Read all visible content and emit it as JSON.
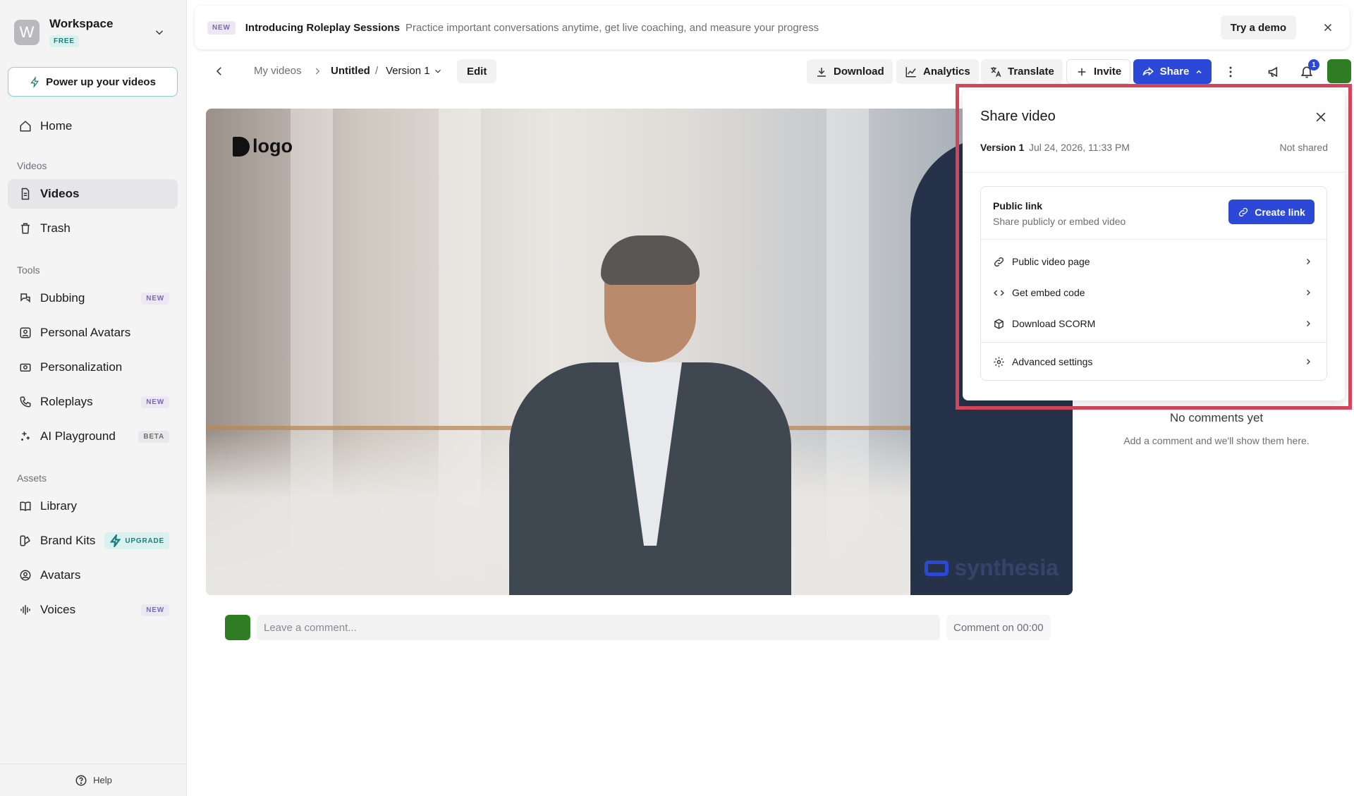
{
  "sidebar": {
    "workspace": {
      "initial": "W",
      "name": "Workspace",
      "plan": "FREE"
    },
    "power_up": "Power up your videos",
    "home": "Home",
    "sections": {
      "videos": "Videos",
      "tools": "Tools",
      "assets": "Assets"
    },
    "videos_items": [
      {
        "label": "Videos",
        "active": true
      },
      {
        "label": "Trash"
      }
    ],
    "tools_items": [
      {
        "label": "Dubbing",
        "badge": "NEW"
      },
      {
        "label": "Personal Avatars"
      },
      {
        "label": "Personalization"
      },
      {
        "label": "Roleplays",
        "badge": "NEW"
      },
      {
        "label": "AI Playground",
        "badge": "BETA"
      }
    ],
    "assets_items": [
      {
        "label": "Library"
      },
      {
        "label": "Brand Kits",
        "badge": "UPGRADE"
      },
      {
        "label": "Avatars"
      },
      {
        "label": "Voices",
        "badge": "NEW"
      }
    ],
    "help": "Help"
  },
  "banner": {
    "badge": "NEW",
    "title": "Introducing Roleplay Sessions",
    "description": "Practice important conversations anytime, get live coaching, and measure your progress",
    "demo": "Try a demo"
  },
  "toolbar": {
    "breadcrumb": {
      "parent": "My videos",
      "title": "Untitled",
      "separator": "/",
      "version": "Version 1"
    },
    "edit": "Edit",
    "download": "Download",
    "analytics": "Analytics",
    "translate": "Translate",
    "invite": "Invite",
    "share": "Share",
    "notifications_count": "1"
  },
  "video": {
    "logo_text": "logo",
    "watermark": "synthesia"
  },
  "comments": {
    "placeholder": "Leave a comment...",
    "timestamp_button": "Comment on 00:00",
    "empty_title": "No comments yet",
    "empty_subtitle": "Add a comment and we'll show them here."
  },
  "share_panel": {
    "title": "Share video",
    "version": "Version 1",
    "date": "Jul 24, 2026, 11:33 PM",
    "status": "Not shared",
    "public_link": {
      "title": "Public link",
      "subtitle": "Share publicly or embed video",
      "button": "Create link"
    },
    "options": {
      "public_page": "Public video page",
      "embed": "Get embed code",
      "scorm": "Download SCORM",
      "advanced": "Advanced settings"
    }
  },
  "colors": {
    "accent": "#2b49d6",
    "highlight": "#d5475c",
    "user": "#2f7d22",
    "teal": "#1d7d7a"
  }
}
